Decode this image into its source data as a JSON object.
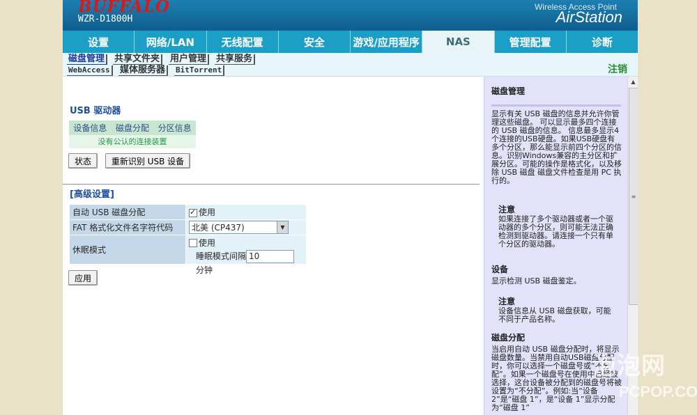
{
  "header": {
    "brand": "BUFFALO",
    "model": "WZR-D1800H",
    "ap_label": "Wireless Access Point",
    "ap_name": "AirStation"
  },
  "nav": {
    "tabs": [
      {
        "label": "设置"
      },
      {
        "label": "网络/LAN"
      },
      {
        "label": "无线配置"
      },
      {
        "label": "安全"
      },
      {
        "label": "游戏/应用程序"
      },
      {
        "label": "NAS",
        "active": true
      },
      {
        "label": "管理配置"
      },
      {
        "label": "诊断"
      }
    ]
  },
  "subnav": {
    "row1": [
      "磁盘管理",
      "共享文件夹",
      "用户管理",
      "共享服务"
    ],
    "row2": [
      "WebAccess",
      "媒体服务器",
      "BitTorrent"
    ],
    "logout": "注销"
  },
  "main": {
    "usb_title": "USB 驱动器",
    "info_tabs": [
      "设备信息",
      "磁盘分配",
      "分区信息"
    ],
    "no_device": "没有公认的连接装置",
    "status_button": "状态",
    "rescan_button": "重新识别 USB 设备",
    "advanced_title": "[高级设置]",
    "auto_assign_label": "自动 USB 磁盘分配",
    "auto_assign_value": "使用",
    "auto_assign_checked": true,
    "fat_label": "FAT 格式化文件名字符代码",
    "fat_value": "北美 (CP437)",
    "sleep_label": "休眠模式",
    "sleep_value": "使用",
    "sleep_checked": false,
    "sleep_interval_label": "睡眠模式间隔",
    "sleep_interval_value": "10",
    "sleep_interval_unit": "分钟",
    "apply_button": "应用"
  },
  "help": {
    "title": "磁盘管理",
    "p1": "显示有关 USB 磁盘的信息并允许你管理这些磁盘。 可以显示最多四个连接的 USB 磁盘的信息。 信息最多显示4个连接的USB硬盘。如果USB硬盘有多个分区，那么能显示前四个分区的信息。识别Windows兼容的主分区和扩展分区。可能的操作是格式化，以及移除 USB 磁盘 磁盘文件检查是用 PC 执行的。",
    "note1_title": "注意",
    "note1": "如果连接了多个驱动器或者一个驱动器的多个分区，则可能无法正确检测到驱动器。请连接一个只有单个分区的驱动器。",
    "device_title": "设备",
    "device_text": "显示检测 USB 磁盘鉴定。",
    "note2_title": "注意",
    "note2": "设备信息从 USB 磁盘获取，可能不同于产品名称。",
    "alloc_title": "磁盘分配",
    "alloc_text": "当启用自动 USB 磁盘分配时，将显示磁盘数量。当禁用自动USB磁盘分配时，你可以选择一个磁盘号或“不分配”。如果一个磁盘号在使用中已经被选择，这台设备被分配到的磁盘号将被设置为“不分配”。例如:当“设备 2”是“磁盘 1”，是“设备 1”显示分配为“磁盘 1”"
  },
  "watermark": {
    "line1": "泡泡网",
    "line2": "PCPOP.COM"
  }
}
